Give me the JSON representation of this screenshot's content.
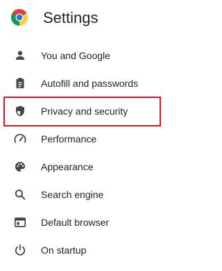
{
  "header": {
    "title": "Settings",
    "logo_icon": "chrome-logo-icon"
  },
  "nav": {
    "items": [
      {
        "label": "You and Google",
        "icon": "person-icon"
      },
      {
        "label": "Autofill and passwords",
        "icon": "clipboard-icon"
      },
      {
        "label": "Privacy and security",
        "icon": "shield-icon"
      },
      {
        "label": "Performance",
        "icon": "speedometer-icon"
      },
      {
        "label": "Appearance",
        "icon": "palette-icon"
      },
      {
        "label": "Search engine",
        "icon": "search-icon"
      },
      {
        "label": "Default browser",
        "icon": "browser-window-icon"
      },
      {
        "label": "On startup",
        "icon": "power-icon"
      }
    ],
    "highlighted_item": "Privacy and security"
  },
  "colors": {
    "highlight_border": "#e8101b",
    "icon": "#444746",
    "text": "#1f1f1f"
  }
}
